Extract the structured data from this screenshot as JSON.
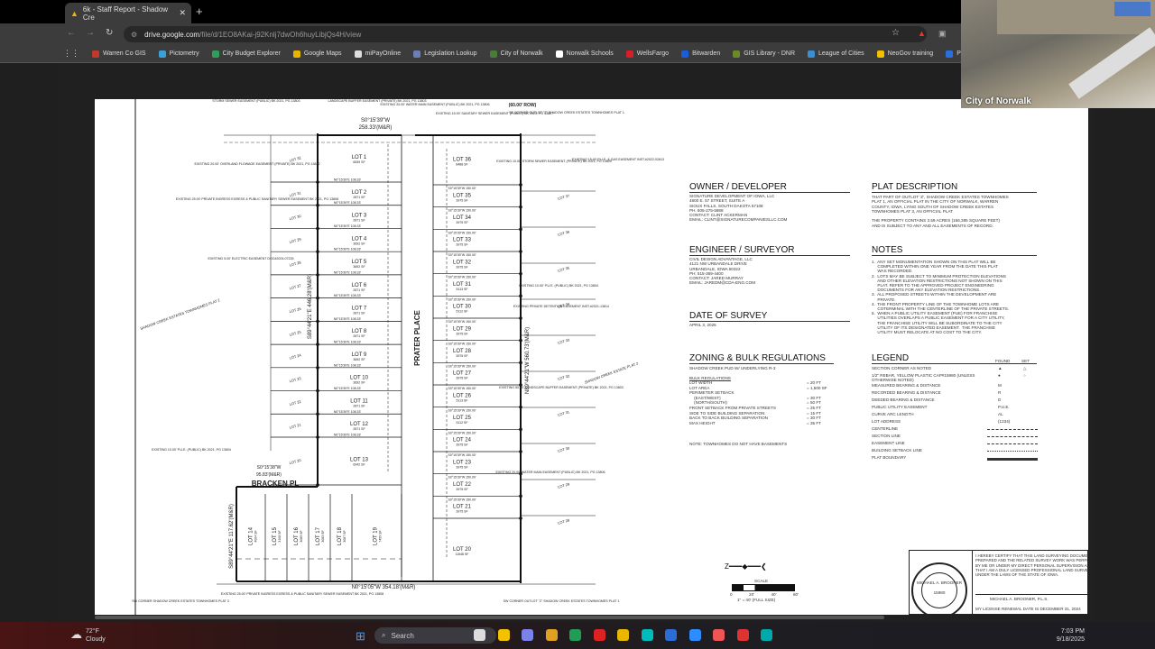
{
  "browser": {
    "tab_title": "6k - Staff Report - Shadow Cre",
    "url_host": "drive.google.com",
    "url_path": "/file/d/1EO8AKai-j92Knlj7dwOh6huyLibjQs4H/view",
    "bookmarks": [
      {
        "label": "Warren Co GIS",
        "color": "#c0392b"
      },
      {
        "label": "Pictometry",
        "color": "#3aa0d8"
      },
      {
        "label": "City Budget Explorer",
        "color": "#2e9e5a"
      },
      {
        "label": "Google Maps",
        "color": "#e8b400"
      },
      {
        "label": "miPayOnline",
        "color": "#dddddd"
      },
      {
        "label": "Legislation Lookup",
        "color": "#6a7fb5"
      },
      {
        "label": "City of Norwalk",
        "color": "#4a7b3a"
      },
      {
        "label": "Norwalk Schools",
        "color": "#ffffff"
      },
      {
        "label": "WellsFargo",
        "color": "#d71e28"
      },
      {
        "label": "Bitwarden",
        "color": "#175ddc"
      },
      {
        "label": "GIS Library - DNR",
        "color": "#6a8a2a"
      },
      {
        "label": "League of Cities",
        "color": "#3b8ed0"
      },
      {
        "label": "NeoGov training",
        "color": "#f2c200"
      },
      {
        "label": "Plan-It! | Imp",
        "color": "#2a6ee0"
      }
    ]
  },
  "webcam": {
    "label": "City of Norwalk"
  },
  "plat": {
    "left_lots": [
      [
        "LOT 1",
        "6539 SF"
      ],
      [
        "LOT 2",
        "2871 SF"
      ],
      [
        "LOT 3",
        "2871 SF"
      ],
      [
        "LOT 4",
        "3692 SF"
      ],
      [
        "LOT 5",
        "3692 SF"
      ],
      [
        "LOT 6",
        "2871 SF"
      ],
      [
        "LOT 7",
        "2871 SF"
      ],
      [
        "LOT 8",
        "2871 SF"
      ],
      [
        "LOT 9",
        "3692 SF"
      ],
      [
        "LOT 10",
        "3692 SF"
      ],
      [
        "LOT 11",
        "2871 SF"
      ],
      [
        "LOT 12",
        "2871 SF"
      ],
      [
        "LOT 13",
        "6942 SF"
      ]
    ],
    "left_bearing": "N0°15'39\"E 108.33'",
    "right_lots": [
      [
        "LOT 36",
        "8488 SF"
      ],
      [
        "LOT 35",
        "3975 SF"
      ],
      [
        "LOT 34",
        "3975 SF"
      ],
      [
        "LOT 33",
        "3975 SF"
      ],
      [
        "LOT 32",
        "3975 SF"
      ],
      [
        "LOT 31",
        "5113 SF"
      ],
      [
        "LOT 30",
        "5112 SF"
      ],
      [
        "LOT 29",
        "3975 SF"
      ],
      [
        "LOT 28",
        "3975 SF"
      ],
      [
        "LOT 27",
        "3975 SF"
      ],
      [
        "LOT 26",
        "5113 SF"
      ],
      [
        "LOT 25",
        "5112 SF"
      ],
      [
        "LOT 24",
        "3975 SF"
      ],
      [
        "LOT 23",
        "3975 SF"
      ],
      [
        "LOT 22",
        "3975 SF"
      ],
      [
        "LOT 21",
        "3975 SF"
      ],
      [
        "LOT 20",
        "11548 SF"
      ]
    ],
    "right_bearing": "S0°15'39\"W 150.00'",
    "bottom_lots": [
      [
        "LOT 14",
        "4004 SF"
      ],
      [
        "LOT 15",
        "3108 SF"
      ],
      [
        "LOT 16",
        "3089 SF"
      ],
      [
        "LOT 17",
        "3083 SF"
      ],
      [
        "LOT 18",
        "3087 SF"
      ],
      [
        "LOT 19",
        "7459 SF"
      ]
    ],
    "street_1": "PRATER PLACE",
    "street_2": "BRACKEN PL",
    "top_bearing": "S0°15'39\"W",
    "top_distance": "258.33'(M&R)",
    "bottom_bearing": "N0°15'05\"W 354.18'(M&R)",
    "west_bearing": "S89°44'21\"E 446.28'(M&R)",
    "east_bearing": "N89°44'21\"W 560.73'(M&R)",
    "sw_bearing": "S89°44'21\"E 117.62'(M&R)",
    "row_label": "(60.00' ROW)",
    "lot20_bearing": "S0°15'38\"W",
    "lot20_dist": "95.83'(M&R)",
    "adjacent_plat_w": "SHADOW CREEK ESTATES TOWNHOMES PLAT 2",
    "adjacent_plat_e": "SHADOW CREEK ESTATE PLAT 2",
    "annotations": [
      "STORM SEWER EASEMENT (PUBLIC) BK 2021, PG 13803",
      "LANDSCAPE BUFFER EASEMENT (PRIVATE) BK 2021, PG 13803",
      "EXISTING 20.00' WATER MAIN EASEMENT (PUBLIC) BK 2021, PG 13806",
      "EXISTING 15.00' SANITARY SEWER EASEMENT (PUBLIC) BK 2021, PG 13807",
      "SE CORNER OUTLOT \"Z\" SHADOW CREEK ESTATES TOWNHOMES PLAT 1",
      "EXISTING 10.00' STORM SEWER EASEMENT (PRIVATE) BK 2021, PG 13809",
      "EXISTING 15.00' P.U.E. & GAS EASEMENT INST.#2022-02613",
      "EXISTING 20.00' OVERLAND FLOWAGE EASEMENT (PRIVATE) BK 2021, PG 13812",
      "EXISTING 25.00' PRIVATE INGRESS EGRESS & PUBLIC SANITARY SEWER EASEMENT BK 2021, PG 13808",
      "EXISTING 5.00' ELECTRIC EASEMENT DOC#2024-07225",
      "EXISTING 10.00' P.U.E. (PUBLIC) BK 2021, PG 13804",
      "EXISTING PRIVATE DETENTION EASEMENT INST.#2021-13814",
      "EXISTING 50.00' LANDSCAPE BUFFER EASEMENT (PRIVATE) BK 2021, PG 13803",
      "EXISTING 20.00' WATER MAIN EASEMENT (PUBLIC) BK 2021, PG 13806",
      "EXISTING 10.00' P.U.E. (PUBLIC) BK 2021, PG 13804",
      "SW CORNER SHADOW CREEK ESTATES TOWNHOMES PLAT 3",
      "EXISTING 25.00' PRIVATE INGRESS EGRESS & PUBLIC SANITARY SEWER EASEMENT BK 2021, PG 13808",
      "SW CORNER OUTLOT \"Z\" SHADOW CREEK ESTATES TOWNHOMES PLAT 1"
    ],
    "adjacent_lots_w": [
      "LOT 32",
      "LOT 31",
      "LOT 30",
      "LOT 29",
      "LOT 28",
      "LOT 27",
      "LOT 26",
      "LOT 25",
      "LOT 24",
      "LOT 23",
      "LOT 22",
      "LOT 21",
      "LOT 20",
      "LOT 19"
    ],
    "adjacent_lots_e": [
      "LOT 37",
      "LOT 36",
      "LOT 35",
      "LOT 34",
      "LOT 33",
      "LOT 32",
      "LOT 31",
      "LOT 30",
      "LOT 29",
      "LOT 28"
    ]
  },
  "sheet": {
    "owner_title": "OWNER / DEVELOPER",
    "owner_text": "SIGNATURE DEVELOPMENT OF IOWA, LLC\n4800 E. 57 STREET, SUITE A\nSIOUX FALLS, SOUTH DAKOTA 57108\nPH. 605-275-5888\nCONTACT: CLINT ACKERMAN\nEMAIL: CLINT@SIGNATURECOMPANIESLLC.COM",
    "engineer_title": "ENGINEER / SURVEYOR",
    "engineer_text": "CIVIL DESIGN ADVANTAGE, LLC\n4121 NW URBANDALE DRIVE\nURBANDALE, IOWA 50322\nPH: 515-369-4400\nCONTACT: JARED MURRAY\nEMAIL: JAREDM@CDA-ENG.COM",
    "date_title": "DATE OF SURVEY",
    "date_text": "APRIL 3, 2025",
    "zoning_title": "ZONING & BULK REGULATIONS",
    "zoning_text": "SHADOW CREEK PUD W/ UNDERLYING R-3",
    "bulk_heading": "BULK REGULATIONS",
    "bulk": [
      [
        "LOT WIDTH",
        "= 20 FT"
      ],
      [
        "LOT AREA",
        "= 1,500 SF"
      ],
      [
        "PERIMETER SETBACK",
        ""
      ],
      [
        "    (EAST/WEST)",
        "= 30 FT"
      ],
      [
        "    (NORTH/SOUTH)",
        "= 50 FT"
      ],
      [
        "FRONT SETBACK FROM PRIVATE STREETS",
        "= 25 FT"
      ],
      [
        "SIDE TO SIDE BUILDING SEPARATION",
        "= 15 FT"
      ],
      [
        "BACK TO BACK BUILDING SEPARATION",
        "= 30 FT"
      ],
      [
        "MAX HEIGHT",
        "= 35 FT"
      ]
    ],
    "zoning_note": "NOTE: TOWNHOMES DO NOT HAVE BASEMENTS",
    "plat_title": "PLAT DESCRIPTION",
    "plat_text": "THAT PART OF OUTLOT 'Z', SHADOW CREEK ESTATES TOWNHOMES\nPLAT 1, AN OFFICIAL PLAT IN THE CITY OF NORWALK, WARREN\nCOUNTY, IOWA, LYING SOUTH OF SHADOW CREEK ESTATES\nTOWNHOMES PLAT 3, AN OFFICIAL PLAT.\n\nTHE PROPERTY CONTAINS 3.59 ACRES (156,385 SQUARE FEET)\nAND IS SUBJECT TO ANY AND ALL EASEMENTS OF RECORD.",
    "notes_title": "NOTES",
    "notes_text": "1.  ANY SET MONUMENTATION SHOWN ON THIS PLAT WILL BE\n     COMPLETED WITHIN ONE YEAR FROM THE DATE THIS PLAT\n     WAS RECORDED.\n2.  LOTS MAY BE SUBJECT TO MINIMUM PROTECTION ELEVATIONS\n     AND OTHER ELEVATION RESTRICTIONS NOT SHOWN ON THIS\n     PLAT. REFER TO THE APPROVED PROJECT ENGINEERING\n     DOCUMENTS FOR ANY ELEVATION RESTRICTIONS.\n3.  ALL PROPOSED STREETS WITHIN THE DEVELOPMENT ARE\n     PRIVATE.\n4.  THE FRONT PROPERTY LINE OF THE TOWNHOME LOTS ARE\n     COTERMINAL WITH THE CENTERLINE OF THE PRIVATE STREETS.\n5.  WHEN A PUBLIC UTILITY EASEMENT (PUE) FOR FRANCHISE\n     UTILITIES OVERLAPS A PUBLIC EASEMENT FOR A CITY UTILITY,\n     THE FRANCHISE UTILITY WILL BE SUBORDINATE TO THE CITY\n     UTILITY OF ITS DESIGNATED EASEMENT.  THE FRANCHISE\n     UTILITY MUST RELOCATE AT NO COST TO THE CITY.",
    "legend_title": "LEGEND",
    "legend_found": "FOUND",
    "legend_set": "SET",
    "legend": [
      [
        "SECTION CORNER AS NOTED",
        "▲",
        "△"
      ],
      [
        "1/2\" REBAR, YELLOW PLASTIC CAP#15980 (UNLESS OTHERWISE NOTED)",
        "●",
        "○"
      ],
      [
        "MEASURED BEARING & DISTANCE",
        "M",
        ""
      ],
      [
        "RECORDED BEARING & DISTANCE",
        "R",
        ""
      ],
      [
        "DEEDED BEARING & DISTANCE",
        "D",
        ""
      ],
      [
        "PUBLIC UTILITY EASEMENT",
        "P.U.E.",
        ""
      ],
      [
        "CURVE ARC LENGTH",
        "AL",
        ""
      ],
      [
        "LOT ADDRESS",
        "(1234)",
        ""
      ],
      [
        "CENTERLINE",
        "",
        ""
      ],
      [
        "SECTION LINE",
        "",
        ""
      ],
      [
        "EASEMENT LINE",
        "",
        ""
      ],
      [
        "BUILDING SETBACK LINE",
        "",
        ""
      ],
      [
        "PLAT BOUNDARY",
        "",
        ""
      ]
    ],
    "scale_label": "SCALE",
    "scale_ticks": [
      "0",
      "20'",
      "40'",
      "80'"
    ],
    "scale_text": "1\" = 40' (FULL SIZE)",
    "seal_name": "MICHAEL A. BROONER",
    "seal_number": "15980",
    "seal_ring": "LICENSED PROFESSIONAL LAND SURVEYOR",
    "cert_text": "I HEREBY CERTIFY THAT THIS LAND SURVEYING DOCUMENT WAS\nPREPARED AND THE RELATED SURVEY WORK WAS PERFORMED\nBY ME OR UNDER MY DIRECT PERSONAL SUPERVISION AND\nTHAT I AM A DULY LICENSED PROFESSIONAL LAND SURVEYOR\nUNDER THE LAWS OF THE STATE OF IOWA.",
    "cert_signer": "MICHAEL A. BROONER, P.L.S.",
    "cert_renewal": "MY LICENSE RENEWAL DATE IS DECEMBER 31, 2024"
  },
  "taskbar": {
    "weather_temp": "72°F",
    "weather_desc": "Cloudy",
    "search_placeholder": "Search",
    "time": "7:03 PM",
    "date": "9/18/2025"
  }
}
